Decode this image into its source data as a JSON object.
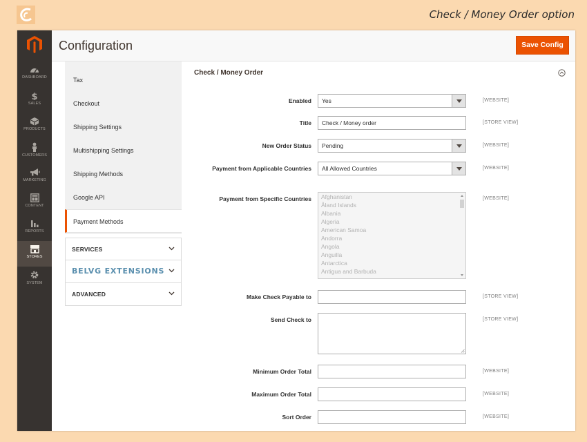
{
  "caption": "Check / Money Order option",
  "header": {
    "title": "Configuration",
    "save_label": "Save Config"
  },
  "nav": {
    "items": [
      {
        "label": "DASHBOARD",
        "icon": "dashboard-icon"
      },
      {
        "label": "SALES",
        "icon": "dollar-icon"
      },
      {
        "label": "PRODUCTS",
        "icon": "box-icon"
      },
      {
        "label": "CUSTOMERS",
        "icon": "person-icon"
      },
      {
        "label": "MARKETING",
        "icon": "megaphone-icon"
      },
      {
        "label": "CONTENT",
        "icon": "layout-icon"
      },
      {
        "label": "REPORTS",
        "icon": "bar-chart-icon"
      },
      {
        "label": "STORES",
        "icon": "store-icon",
        "active": true
      },
      {
        "label": "SYSTEM",
        "icon": "gear-icon"
      }
    ]
  },
  "tabs": {
    "items": [
      {
        "label": "Tax"
      },
      {
        "label": "Checkout"
      },
      {
        "label": "Shipping Settings"
      },
      {
        "label": "Multishipping Settings"
      },
      {
        "label": "Shipping Methods"
      },
      {
        "label": "Google API"
      },
      {
        "label": "Payment Methods",
        "active": true
      }
    ],
    "groups": [
      {
        "label": "SERVICES"
      },
      {
        "label": "BELVG EXTENSIONS"
      },
      {
        "label": "ADVANCED"
      }
    ]
  },
  "section": {
    "title": "Check / Money Order"
  },
  "fields": {
    "enabled": {
      "label": "Enabled",
      "value": "Yes",
      "scope": "[WEBSITE]"
    },
    "title": {
      "label": "Title",
      "value": "Check / Money order",
      "scope": "[STORE VIEW]"
    },
    "order_status": {
      "label": "New Order Status",
      "value": "Pending",
      "scope": "[WEBSITE]"
    },
    "applicable_countries": {
      "label": "Payment from Applicable Countries",
      "value": "All Allowed Countries",
      "scope": "[WEBSITE]"
    },
    "specific_countries": {
      "label": "Payment from Specific Countries",
      "scope": "[WEBSITE]",
      "options": [
        "Afghanistan",
        "Åland Islands",
        "Albania",
        "Algeria",
        "American Samoa",
        "Andorra",
        "Angola",
        "Anguilla",
        "Antarctica",
        "Antigua and Barbuda"
      ]
    },
    "payable_to": {
      "label": "Make Check Payable to",
      "value": "",
      "scope": "[STORE VIEW]"
    },
    "send_check_to": {
      "label": "Send Check to",
      "value": "",
      "scope": "[STORE VIEW]"
    },
    "min_total": {
      "label": "Minimum Order Total",
      "value": "",
      "scope": "[WEBSITE]"
    },
    "max_total": {
      "label": "Maximum Order Total",
      "value": "",
      "scope": "[WEBSITE]"
    },
    "sort_order": {
      "label": "Sort Order",
      "value": "",
      "scope": "[WEBSITE]"
    }
  },
  "colors": {
    "accent": "#eb5202",
    "nav_bg": "#373330",
    "page_bg": "#fbd9b0"
  }
}
